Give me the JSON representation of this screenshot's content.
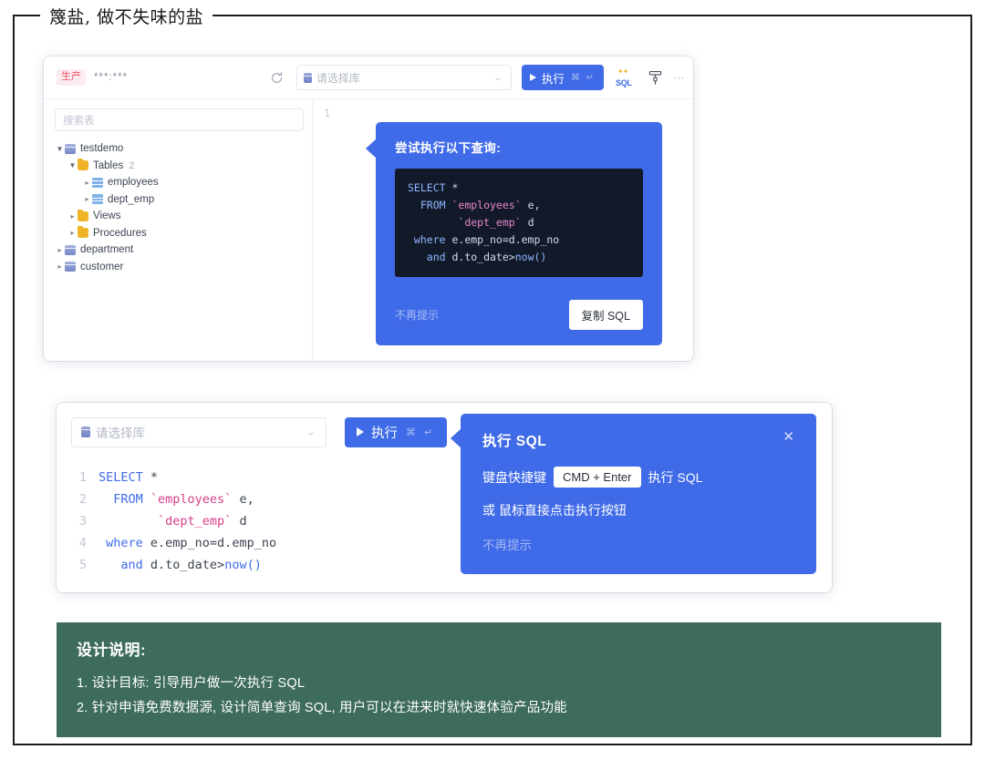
{
  "frame": {
    "title": "篾盐, 做不失味的盐"
  },
  "ide": {
    "toolbar": {
      "env_badge": "生产",
      "connection_masked": "***:***",
      "refresh_icon": "refresh-icon",
      "db_select_placeholder": "请选择库",
      "db_select_chevron": "⌄",
      "execute_label": "执行",
      "execute_shortcut": "⌘ ↵",
      "sql_beautify_icon": "sql-format-icon",
      "sql_beautify_label": "SQL",
      "brush_icon": "brush-icon",
      "overflow_dots": "⋯"
    },
    "tree": {
      "search_placeholder": "搜索表",
      "items": [
        {
          "label": "testdemo",
          "icon": "database-icon",
          "indent": 0,
          "caret": "▼",
          "count": ""
        },
        {
          "label": "Tables",
          "icon": "folder-icon",
          "indent": 1,
          "caret": "▼",
          "count": "2"
        },
        {
          "label": "employees",
          "icon": "table-icon",
          "indent": 2,
          "caret": "▸",
          "count": ""
        },
        {
          "label": "dept_emp",
          "icon": "table-icon",
          "indent": 2,
          "caret": "▸",
          "count": ""
        },
        {
          "label": "Views",
          "icon": "folder-icon",
          "indent": 1,
          "caret": "▸",
          "count": ""
        },
        {
          "label": "Procedures",
          "icon": "folder-icon",
          "indent": 1,
          "caret": "▸",
          "count": ""
        },
        {
          "label": "department",
          "icon": "database-icon",
          "indent": 0,
          "caret": "▸",
          "count": ""
        },
        {
          "label": "customer",
          "icon": "database-icon",
          "indent": 0,
          "caret": "▸",
          "count": ""
        }
      ]
    },
    "editor": {
      "line_numbers": [
        "1"
      ]
    }
  },
  "tip_query": {
    "title": "尝试执行以下查询:",
    "dismiss_label": "不再提示",
    "copy_label": "复制 SQL",
    "code_lines": [
      [
        {
          "t": "SELECT",
          "c": "k"
        },
        {
          "t": " *",
          "c": "p"
        }
      ],
      [
        {
          "t": "  FROM ",
          "c": "k"
        },
        {
          "t": "`employees`",
          "c": "t"
        },
        {
          "t": " e,",
          "c": "p"
        }
      ],
      [
        {
          "t": "        ",
          "c": "p"
        },
        {
          "t": "`dept_emp`",
          "c": "t"
        },
        {
          "t": " d",
          "c": "p"
        }
      ],
      [
        {
          "t": " where",
          "c": "k"
        },
        {
          "t": " e.emp_no=d.emp_no",
          "c": "p"
        }
      ],
      [
        {
          "t": "   and",
          "c": "k"
        },
        {
          "t": " d.to_date>",
          "c": "p"
        },
        {
          "t": "now()",
          "c": "f"
        }
      ]
    ]
  },
  "editor_panel": {
    "db_select_placeholder": "请选择库",
    "db_select_chevron": "⌄",
    "execute_label": "执行",
    "execute_shortcut": "⌘ ↵",
    "code_lines": [
      {
        "num": "1",
        "parts": [
          {
            "t": "SELECT",
            "c": "k"
          },
          {
            "t": " *",
            "c": "p"
          }
        ]
      },
      {
        "num": "2",
        "parts": [
          {
            "t": "  FROM ",
            "c": "k"
          },
          {
            "t": "`employees`",
            "c": "t"
          },
          {
            "t": " e,",
            "c": "p"
          }
        ]
      },
      {
        "num": "3",
        "parts": [
          {
            "t": "        ",
            "c": "p"
          },
          {
            "t": "`dept_emp`",
            "c": "t"
          },
          {
            "t": " d",
            "c": "p"
          }
        ]
      },
      {
        "num": "4",
        "parts": [
          {
            "t": " where",
            "c": "k"
          },
          {
            "t": " e.emp_no=d.emp_no",
            "c": "p"
          }
        ]
      },
      {
        "num": "5",
        "parts": [
          {
            "t": "   and",
            "c": "k"
          },
          {
            "t": " d.to_date>",
            "c": "p"
          },
          {
            "t": "now()",
            "c": "f"
          }
        ]
      }
    ]
  },
  "tip_shortcut": {
    "title": "执行 SQL",
    "close_icon": "✕",
    "line1_prefix": "键盘快捷键",
    "key_chip": "CMD + Enter",
    "line1_suffix": "执行 SQL",
    "line2": "或 鼠标直接点击执行按钮",
    "dismiss_label": "不再提示"
  },
  "notes": {
    "title": "设计说明:",
    "items": [
      "1. 设计目标: 引导用户做一次执行 SQL",
      "2. 针对申请免费数据源, 设计简单查询 SQL, 用户可以在进来时就快速体验产品功能"
    ]
  },
  "colors": {
    "brand_blue": "#3f6ae8",
    "code_dark_bg": "#121a2a",
    "notes_green": "#3d6b5c",
    "env_badge_red": "#e8536a",
    "keyword_dark": "#8fb6ff",
    "table_dark": "#e886c8",
    "keyword_light": "#3f6ae8",
    "table_light": "#d6418a"
  }
}
